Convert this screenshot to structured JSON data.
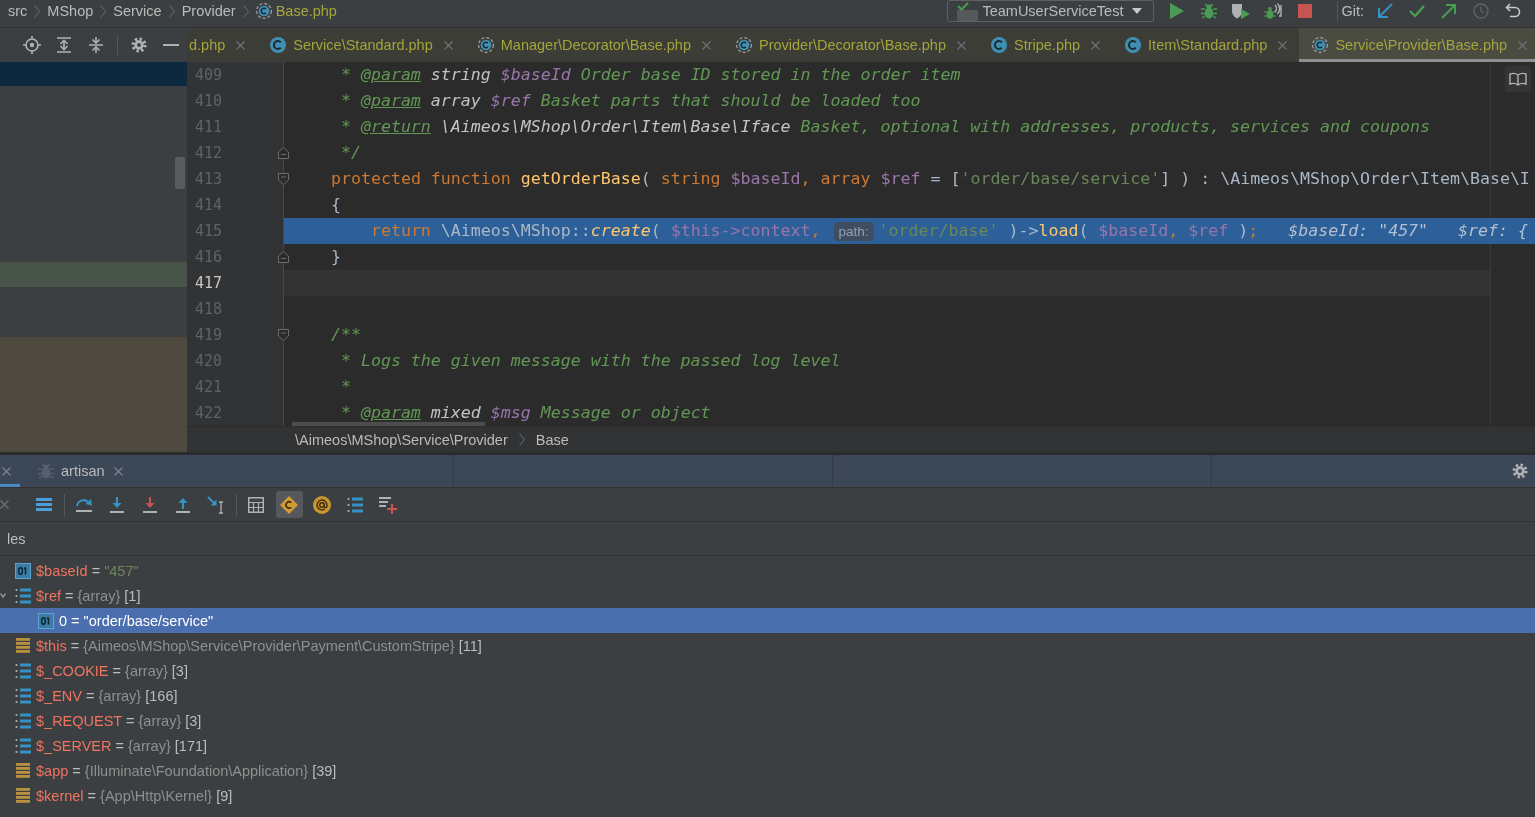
{
  "navigation_bar": {
    "breadcrumbs": [
      {
        "label": "src",
        "kind": "folder"
      },
      {
        "label": "MShop",
        "kind": "folder"
      },
      {
        "label": "Service",
        "kind": "folder"
      },
      {
        "label": "Provider",
        "kind": "folder"
      },
      {
        "label": "Base.php",
        "kind": "file"
      }
    ]
  },
  "run_toolbar": {
    "configuration": "TeamUserServiceTest",
    "vcs_label": "Git:"
  },
  "editor_tabs": [
    {
      "label": "d.php",
      "kind": "plain",
      "selected": false
    },
    {
      "label": "Service\\Standard.php",
      "kind": "class",
      "selected": false
    },
    {
      "label": "Manager\\Decorator\\Base.php",
      "kind": "abstract",
      "selected": false
    },
    {
      "label": "Provider\\Decorator\\Base.php",
      "kind": "abstract",
      "selected": false
    },
    {
      "label": "Stripe.php",
      "kind": "class",
      "selected": false
    },
    {
      "label": "Item\\Standard.php",
      "kind": "class",
      "selected": false
    },
    {
      "label": "Service\\Provider\\Base.php",
      "kind": "abstract",
      "selected": true
    }
  ],
  "editor": {
    "lines": [
      {
        "number": "409",
        "execution_point": false,
        "caret_line": false,
        "fold_start": false,
        "fold_end": false,
        "tokens": [
          {
            "kind": "doc",
            "text": "     * "
          },
          {
            "kind": "doc_tag",
            "text": "@param"
          },
          {
            "kind": "doc_type",
            "text": " string "
          },
          {
            "kind": "doc_var",
            "text": "$baseId"
          },
          {
            "kind": "doc",
            "text": " Order base ID stored in the order item"
          }
        ]
      },
      {
        "number": "410",
        "execution_point": false,
        "caret_line": false,
        "fold_start": false,
        "fold_end": false,
        "tokens": [
          {
            "kind": "doc",
            "text": "     * "
          },
          {
            "kind": "doc_tag",
            "text": "@param"
          },
          {
            "kind": "doc_type",
            "text": " array "
          },
          {
            "kind": "doc_var",
            "text": "$ref"
          },
          {
            "kind": "doc",
            "text": " Basket parts that should be loaded too"
          }
        ]
      },
      {
        "number": "411",
        "execution_point": false,
        "caret_line": false,
        "fold_start": false,
        "fold_end": false,
        "tokens": [
          {
            "kind": "doc",
            "text": "     * "
          },
          {
            "kind": "doc_tag",
            "text": "@return"
          },
          {
            "kind": "doc_type",
            "text": " \\Aimeos\\MShop\\Order\\Item\\Base\\Iface"
          },
          {
            "kind": "doc",
            "text": " Basket, optional with addresses, products, services and coupons"
          }
        ]
      },
      {
        "number": "412",
        "execution_point": false,
        "caret_line": false,
        "fold_start": false,
        "fold_end": true,
        "tokens": [
          {
            "kind": "doc",
            "text": "     */"
          }
        ]
      },
      {
        "number": "413",
        "execution_point": false,
        "caret_line": false,
        "fold_start": true,
        "fold_end": false,
        "tokens": [
          {
            "kind": "keyword",
            "text": "    protected function "
          },
          {
            "kind": "function",
            "text": "getOrderBase"
          },
          {
            "kind": "plain",
            "text": "( "
          },
          {
            "kind": "keyword",
            "text": "string "
          },
          {
            "kind": "variable",
            "text": "$baseId"
          },
          {
            "kind": "separator",
            "text": ", "
          },
          {
            "kind": "keyword",
            "text": "array "
          },
          {
            "kind": "variable",
            "text": "$ref"
          },
          {
            "kind": "plain",
            "text": " = ["
          },
          {
            "kind": "string",
            "text": "'order/base/service'"
          },
          {
            "kind": "plain",
            "text": "] ) : \\Aimeos\\MShop\\Order\\Item\\Base\\I"
          }
        ]
      },
      {
        "number": "414",
        "execution_point": false,
        "caret_line": false,
        "fold_start": false,
        "fold_end": false,
        "tokens": [
          {
            "kind": "plain",
            "text": "    {"
          }
        ]
      },
      {
        "number": "415",
        "execution_point": true,
        "caret_line": false,
        "fold_start": false,
        "fold_end": false,
        "tokens": [
          {
            "kind": "keyword",
            "text": "        return "
          },
          {
            "kind": "plain",
            "text": "\\Aimeos\\MShop::"
          },
          {
            "kind": "static_call",
            "text": "create"
          },
          {
            "kind": "plain",
            "text": "( "
          },
          {
            "kind": "variable",
            "text": "$this->context"
          },
          {
            "kind": "separator",
            "text": ", "
          },
          {
            "kind": "hint",
            "text": "path:"
          },
          {
            "kind": "string",
            "text": "'order/base'"
          },
          {
            "kind": "plain",
            "text": " )->"
          },
          {
            "kind": "function",
            "text": "load"
          },
          {
            "kind": "plain",
            "text": "( "
          },
          {
            "kind": "variable",
            "text": "$baseId"
          },
          {
            "kind": "separator",
            "text": ", "
          },
          {
            "kind": "variable",
            "text": "$ref"
          },
          {
            "kind": "plain",
            "text": " )"
          },
          {
            "kind": "separator",
            "text": ";"
          },
          {
            "kind": "inline_value",
            "text": "$baseId: \"457\""
          },
          {
            "kind": "inline_value",
            "text": "$ref: {"
          }
        ]
      },
      {
        "number": "416",
        "execution_point": false,
        "caret_line": false,
        "fold_start": false,
        "fold_end": true,
        "tokens": [
          {
            "kind": "plain",
            "text": "    }"
          }
        ]
      },
      {
        "number": "417",
        "execution_point": false,
        "caret_line": true,
        "fold_start": false,
        "fold_end": false
      },
      {
        "number": "418",
        "execution_point": false,
        "caret_line": false,
        "fold_start": false,
        "fold_end": false
      },
      {
        "number": "419",
        "execution_point": false,
        "caret_line": false,
        "fold_start": true,
        "fold_end": false,
        "tokens": [
          {
            "kind": "doc",
            "text": "    /**"
          }
        ]
      },
      {
        "number": "420",
        "execution_point": false,
        "caret_line": false,
        "fold_start": false,
        "fold_end": false,
        "tokens": [
          {
            "kind": "doc",
            "text": "     * Logs the given message with the passed log level"
          }
        ]
      },
      {
        "number": "421",
        "execution_point": false,
        "caret_line": false,
        "fold_start": false,
        "fold_end": false,
        "tokens": [
          {
            "kind": "doc",
            "text": "     *"
          }
        ]
      },
      {
        "number": "422",
        "execution_point": false,
        "caret_line": false,
        "fold_start": false,
        "fold_end": false,
        "tokens": [
          {
            "kind": "doc",
            "text": "     * "
          },
          {
            "kind": "doc_tag",
            "text": "@param"
          },
          {
            "kind": "doc_type",
            "text": " mixed "
          },
          {
            "kind": "doc_var",
            "text": "$msg"
          },
          {
            "kind": "doc",
            "text": " Message or object"
          }
        ]
      }
    ],
    "breadcrumbs": [
      "\\Aimeos\\MShop\\Service\\Provider",
      "Base"
    ]
  },
  "debug_panel": {
    "sessions": [
      {
        "selected": true
      },
      {
        "label": "artisan",
        "selected": false
      }
    ],
    "toggles": [
      {
        "kind": "constants",
        "on": true
      },
      {
        "kind": "references",
        "on": false
      }
    ],
    "section_title": "les",
    "variables": [
      {
        "kind": "primitive",
        "name": "$baseId",
        "operator": "=",
        "value": "\"457\"",
        "selected": false
      },
      {
        "kind": "array",
        "name": "$ref",
        "operator": "=",
        "type": "{array}",
        "count": "[1]",
        "expanded": true,
        "selected": false,
        "children": [
          {
            "kind": "primitive",
            "name": "0",
            "operator": "=",
            "value": "\"order/base/service\"",
            "selected": true
          }
        ]
      },
      {
        "kind": "object",
        "name": "$this",
        "operator": "=",
        "type": "{Aimeos\\MShop\\Service\\Provider\\Payment\\CustomStripe}",
        "count": "[11]",
        "expanded": false,
        "selected": false
      },
      {
        "kind": "array",
        "name": "$_COOKIE",
        "operator": "=",
        "type": "{array}",
        "count": "[3]",
        "expanded": false,
        "selected": false
      },
      {
        "kind": "array",
        "name": "$_ENV",
        "operator": "=",
        "type": "{array}",
        "count": "[166]",
        "expanded": false,
        "selected": false
      },
      {
        "kind": "array",
        "name": "$_REQUEST",
        "operator": "=",
        "type": "{array}",
        "count": "[3]",
        "expanded": false,
        "selected": false
      },
      {
        "kind": "array",
        "name": "$_SERVER",
        "operator": "=",
        "type": "{array}",
        "count": "[171]",
        "expanded": false,
        "selected": false
      },
      {
        "kind": "object",
        "name": "$app",
        "operator": "=",
        "type": "{Illuminate\\Foundation\\Application}",
        "count": "[39]",
        "expanded": false,
        "selected": false
      },
      {
        "kind": "object",
        "name": "$kernel",
        "operator": "=",
        "type": "{App\\Http\\Kernel}",
        "count": "[9]",
        "expanded": false,
        "selected": false
      }
    ]
  }
}
